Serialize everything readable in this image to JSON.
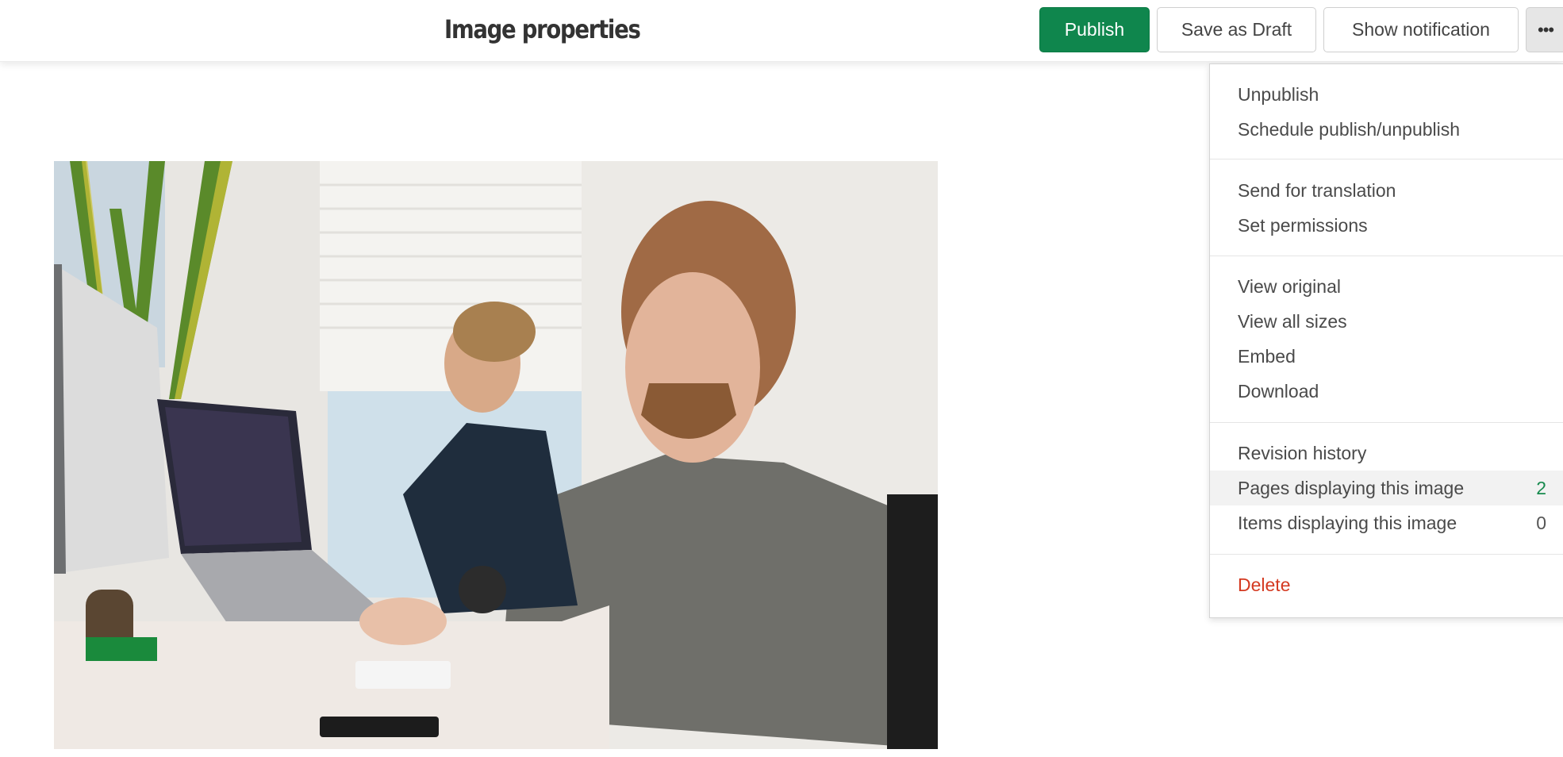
{
  "header": {
    "title": "Image properties",
    "buttons": {
      "publish": "Publish",
      "save_draft": "Save as Draft",
      "show_notification": "Show notification",
      "more": "•••"
    }
  },
  "colors": {
    "primary": "#0f864d",
    "danger": "#d43a21",
    "count_highlight": "#178a4e"
  },
  "image": {
    "description": "Two men working at desks with laptops and monitors in a bright office"
  },
  "more_menu": {
    "groups": [
      {
        "items": [
          {
            "label": "Unpublish"
          },
          {
            "label": "Schedule publish/unpublish"
          }
        ]
      },
      {
        "items": [
          {
            "label": "Send for translation"
          },
          {
            "label": "Set permissions"
          }
        ]
      },
      {
        "items": [
          {
            "label": "View original"
          },
          {
            "label": "View all sizes"
          },
          {
            "label": "Embed"
          },
          {
            "label": "Download"
          }
        ]
      },
      {
        "items": [
          {
            "label": "Revision history"
          },
          {
            "label": "Pages displaying this image",
            "count": "2",
            "highlighted": true
          },
          {
            "label": "Items displaying this image",
            "count": "0"
          }
        ]
      },
      {
        "items": [
          {
            "label": "Delete",
            "danger": true
          }
        ]
      }
    ]
  }
}
